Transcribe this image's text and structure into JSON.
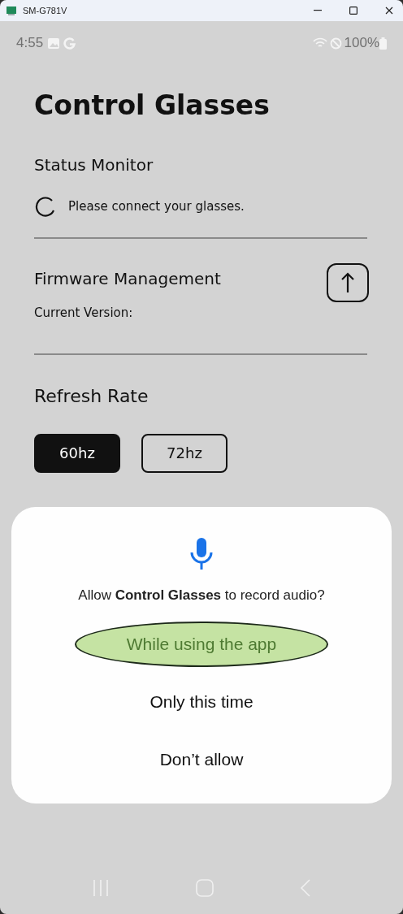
{
  "window": {
    "title": "SM-G781V"
  },
  "status_bar": {
    "time": "4:55",
    "battery": "100%"
  },
  "app": {
    "title": "Control Glasses",
    "status_monitor": {
      "heading": "Status Monitor",
      "message": "Please connect your glasses."
    },
    "firmware": {
      "heading": "Firmware Management",
      "current_version_label": "Current Version:"
    },
    "refresh_rate": {
      "heading": "Refresh Rate",
      "options": [
        {
          "label": "60hz",
          "selected": true
        },
        {
          "label": "72hz",
          "selected": false
        }
      ]
    }
  },
  "permission_dialog": {
    "prompt": "Allow **Control Glasses** to record audio?",
    "options": [
      {
        "label": "While using the app",
        "selected": true
      },
      {
        "label": "Only this time",
        "selected": false
      },
      {
        "label": "Don’t allow",
        "selected": false
      }
    ]
  }
}
